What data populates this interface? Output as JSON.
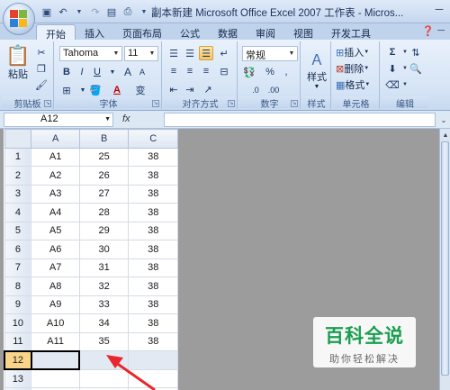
{
  "window": {
    "title": "副本新建 Microsoft Office Excel 2007 工作表 - Micros..."
  },
  "tabs": [
    "开始",
    "插入",
    "页面布局",
    "公式",
    "数据",
    "审阅",
    "视图",
    "开发工具"
  ],
  "ribbon": {
    "clipboard": {
      "label": "剪贴板",
      "paste": "粘贴"
    },
    "font": {
      "label": "字体",
      "name": "Tahoma",
      "size": "11",
      "bold": "B",
      "italic": "I",
      "underline": "U",
      "grow": "A",
      "shrink": "A",
      "color_letter": "A",
      "pinyin": "变"
    },
    "align": {
      "label": "对齐方式"
    },
    "number": {
      "label": "数字",
      "format": "常规"
    },
    "styles": {
      "label": "样式",
      "button": "样式"
    },
    "cells": {
      "label": "单元格",
      "insert": "插入",
      "delete": "删除",
      "format": "格式"
    },
    "editing": {
      "label": "编辑"
    }
  },
  "formula_bar": {
    "name_box": "A12",
    "fx": "fx",
    "value": ""
  },
  "sheet": {
    "columns": [
      "A",
      "B",
      "C"
    ],
    "rows": [
      [
        "A1",
        "25",
        "38"
      ],
      [
        "A2",
        "26",
        "38"
      ],
      [
        "A3",
        "27",
        "38"
      ],
      [
        "A4",
        "28",
        "38"
      ],
      [
        "A5",
        "29",
        "38"
      ],
      [
        "A6",
        "30",
        "38"
      ],
      [
        "A7",
        "31",
        "38"
      ],
      [
        "A8",
        "32",
        "38"
      ],
      [
        "A9",
        "33",
        "38"
      ],
      [
        "A10",
        "34",
        "38"
      ],
      [
        "A11",
        "35",
        "38"
      ],
      [
        "",
        "",
        ""
      ],
      [
        "",
        "",
        ""
      ],
      [
        "",
        "",
        ""
      ]
    ],
    "selected_row": 12
  },
  "watermark": {
    "title": "百科全说",
    "subtitle": "助你轻松解决"
  },
  "colors": {
    "accent": "#f6c863",
    "arrow": "#e8262b",
    "watermark_green": "#1a9e50"
  }
}
